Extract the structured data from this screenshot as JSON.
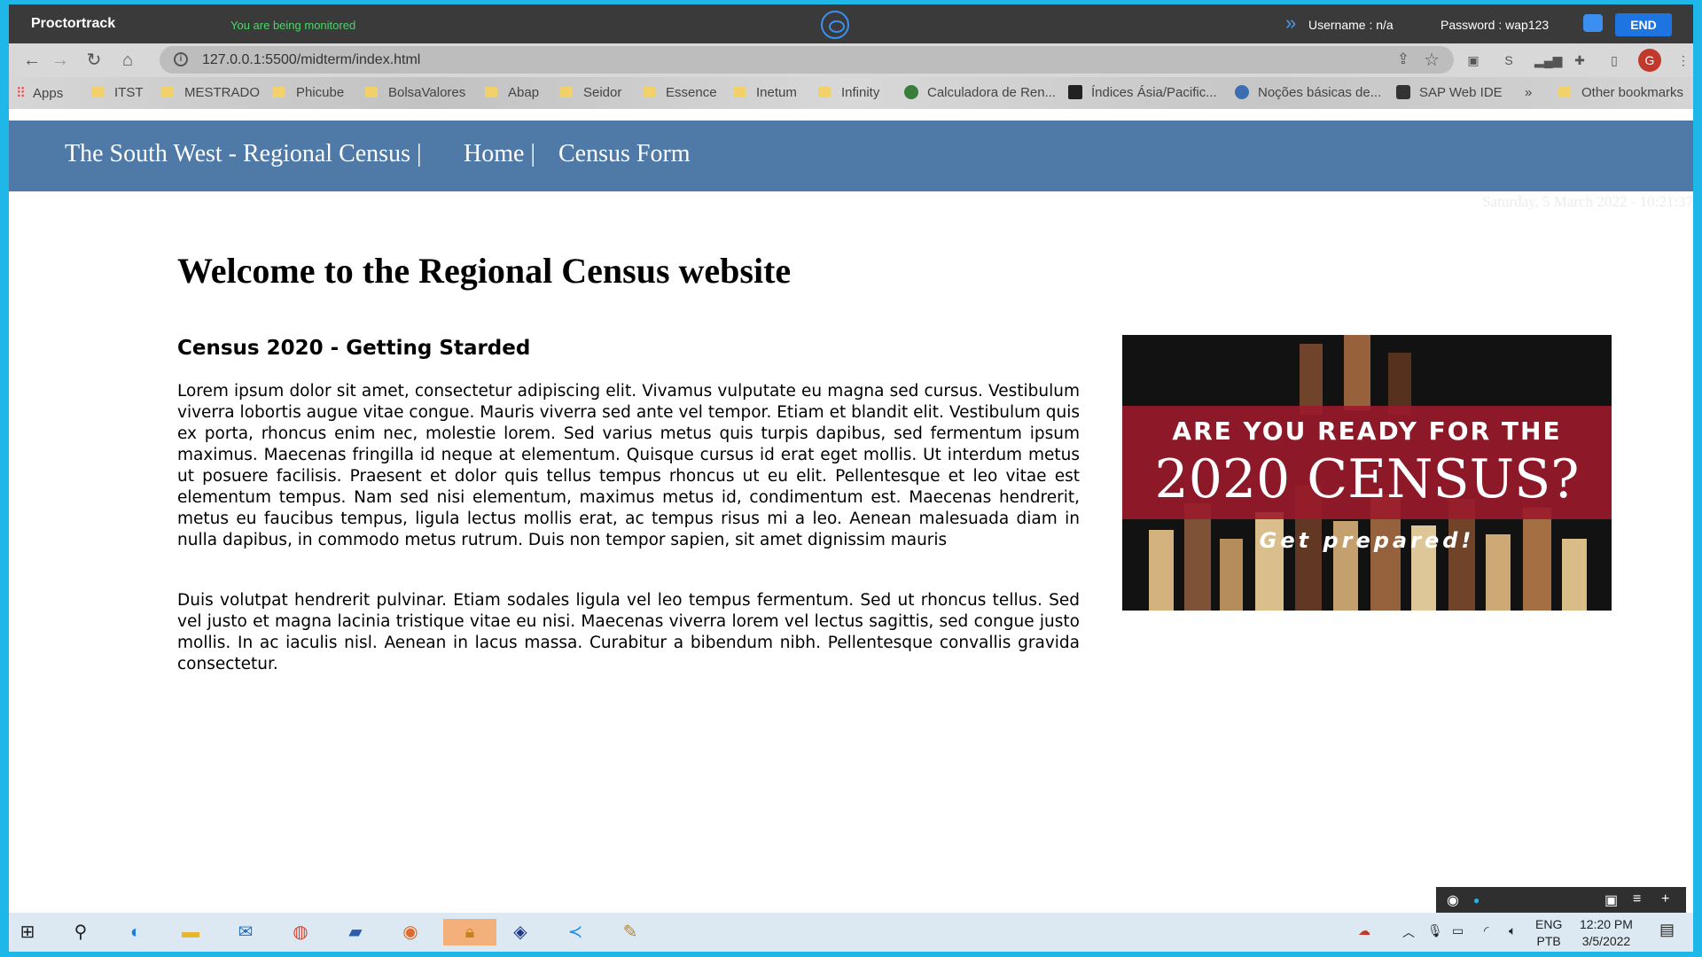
{
  "proctor": {
    "brand": "Proctortrack",
    "status": "You are being monitored",
    "username": "Username : n/a",
    "password": "Password : wap123",
    "end_label": "END"
  },
  "browser": {
    "url": "127.0.0.1:5500/midterm/index.html",
    "profile_initial": "G",
    "bookmarks": [
      "Apps",
      "ITST",
      "MESTRADO",
      "Phicube",
      "BolsaValores",
      "Abap",
      "Seidor",
      "Essence",
      "Inetum",
      "Infinity",
      "Calculadora de Ren...",
      "Índices Ásia/Pacific...",
      "Noções básicas de...",
      "SAP Web IDE"
    ],
    "more_bookmarks": "»",
    "other_bookmarks": "Other bookmarks"
  },
  "page": {
    "nav": {
      "site_title": "The South West - Regional Census |",
      "home": "Home |",
      "census_form": "Census Form"
    },
    "date": "Saturday, 5 March 2022 - 10:21:37",
    "title": "Welcome to the Regional Census website",
    "section_heading": "Census 2020 - Getting Starded",
    "paragraph1": "Lorem ipsum dolor sit amet, consectetur adipiscing elit. Vivamus vulputate eu magna sed cursus. Vestibulum viverra lobortis augue vitae congue. Mauris viverra sed ante vel tempor. Etiam et blandit elit. Vestibulum quis ex porta, rhoncus enim nec, molestie lorem. Sed varius metus quis turpis dapibus, sed fermentum ipsum maximus. Maecenas fringilla id neque at elementum. Quisque cursus id erat eget mollis. Ut interdum metus ut posuere facilisis. Praesent et dolor quis tellus tempus rhoncus ut eu elit. Pellentesque et leo vitae est elementum tempus. Nam sed nisi elementum, maximus metus id, condimentum est. Maecenas hendrerit, metus eu faucibus tempus, ligula lectus mollis erat, ac tempus risus mi a leo. Aenean malesuada diam in nulla dapibus, in commodo metus rutrum. Duis non tempor sapien, sit amet dignissim mauris",
    "paragraph2": "Duis volutpat hendrerit pulvinar. Etiam sodales ligula vel leo tempus fermentum. Sed ut rhoncus tellus. Sed vel justo et magna lacinia tristique vitae eu nisi. Maecenas viverra lorem vel lectus sagittis, sed congue justo mollis. In ac iaculis nisl. Aenean in lacus massa. Curabitur a bibendum nibh. Pellentesque convallis gravida consectetur.",
    "image": {
      "line1": "ARE YOU READY FOR THE",
      "line2": "2020 CENSUS?",
      "line3": "Get prepared!"
    }
  },
  "taskbar": {
    "lang_top": "ENG",
    "lang_bottom": "PTB",
    "time": "12:20 PM",
    "date": "3/5/2022"
  },
  "colors": {
    "nav_bg": "#4f79a6",
    "proctor_bg": "#3a3a3a",
    "end_button": "#1e74e0",
    "monitor_text": "#4fd36b",
    "frame": "#1fb6e8"
  }
}
